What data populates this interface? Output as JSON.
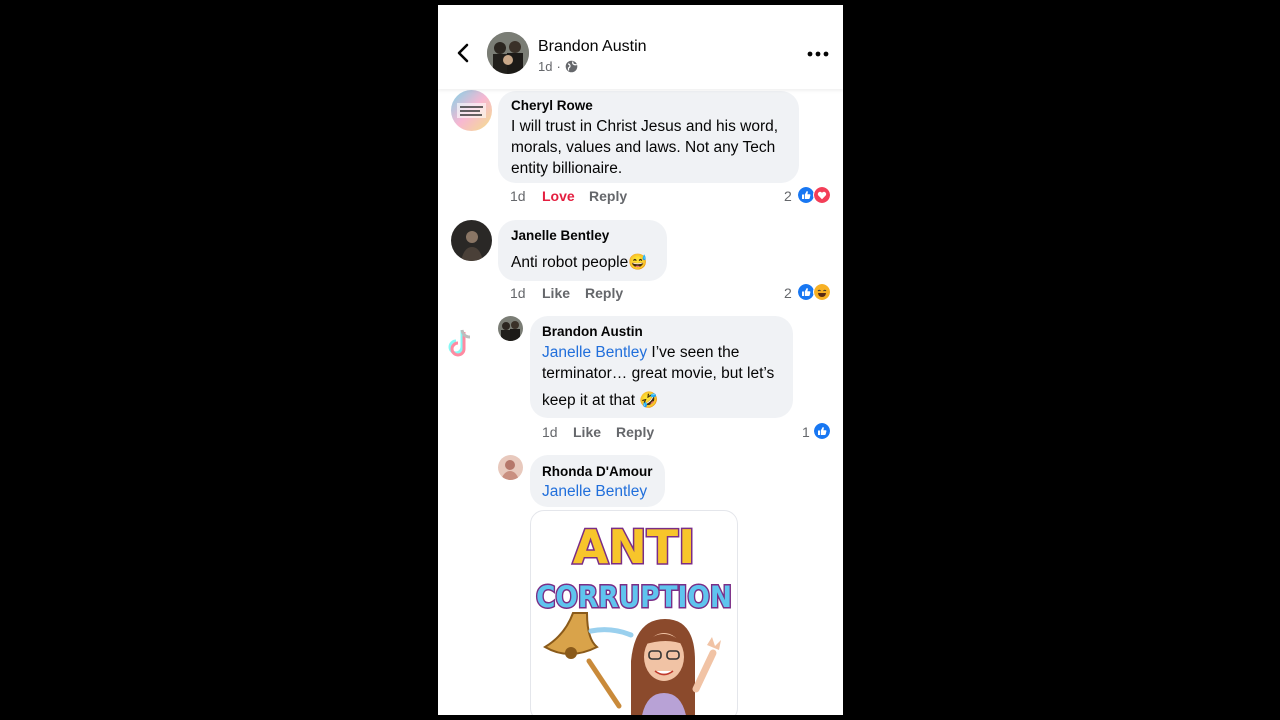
{
  "post": {
    "author": "Brandon Austin",
    "age": "1d",
    "separator": "·",
    "privacy_icon": "globe-icon"
  },
  "watermark": {
    "app": "TikTok",
    "icon": "tiktok-icon"
  },
  "colors": {
    "mention": "#216fdb",
    "love": "#e41e3f",
    "like": "#1877f2",
    "bubble": "#f0f2f5"
  },
  "comments": [
    {
      "author": "Cheryl Rowe",
      "lines": [
        "I will trust in Christ Jesus and his word,",
        "morals, values and laws. Not any Tech",
        "entity billionaire."
      ],
      "age": "1d",
      "reaction_label": "Love",
      "reply_label": "Reply",
      "reaction_count": "2",
      "reactions": [
        "like-icon",
        "heart-icon"
      ]
    },
    {
      "author": "Janelle Bentley",
      "text": "Anti robot people",
      "emoji": "😅",
      "age": "1d",
      "reaction_label": "Like",
      "reply_label": "Reply",
      "reaction_count": "2",
      "reactions": [
        "like-icon",
        "haha-icon"
      ]
    },
    {
      "author": "Brandon Austin",
      "mention": "Janelle Bentley",
      "line1_rest": " I’ve seen the",
      "line2": "terminator… great movie, but let’s",
      "line3": "keep it at that",
      "emoji": "🤣",
      "age": "1d",
      "reaction_label": "Like",
      "reply_label": "Reply",
      "reaction_count": "1",
      "reactions": [
        "like-icon"
      ]
    },
    {
      "author": "Rhonda D'Amour",
      "mention": "Janelle Bentley",
      "sticker": {
        "line1": "ANTI",
        "line2": "CORRUPTION"
      }
    }
  ]
}
